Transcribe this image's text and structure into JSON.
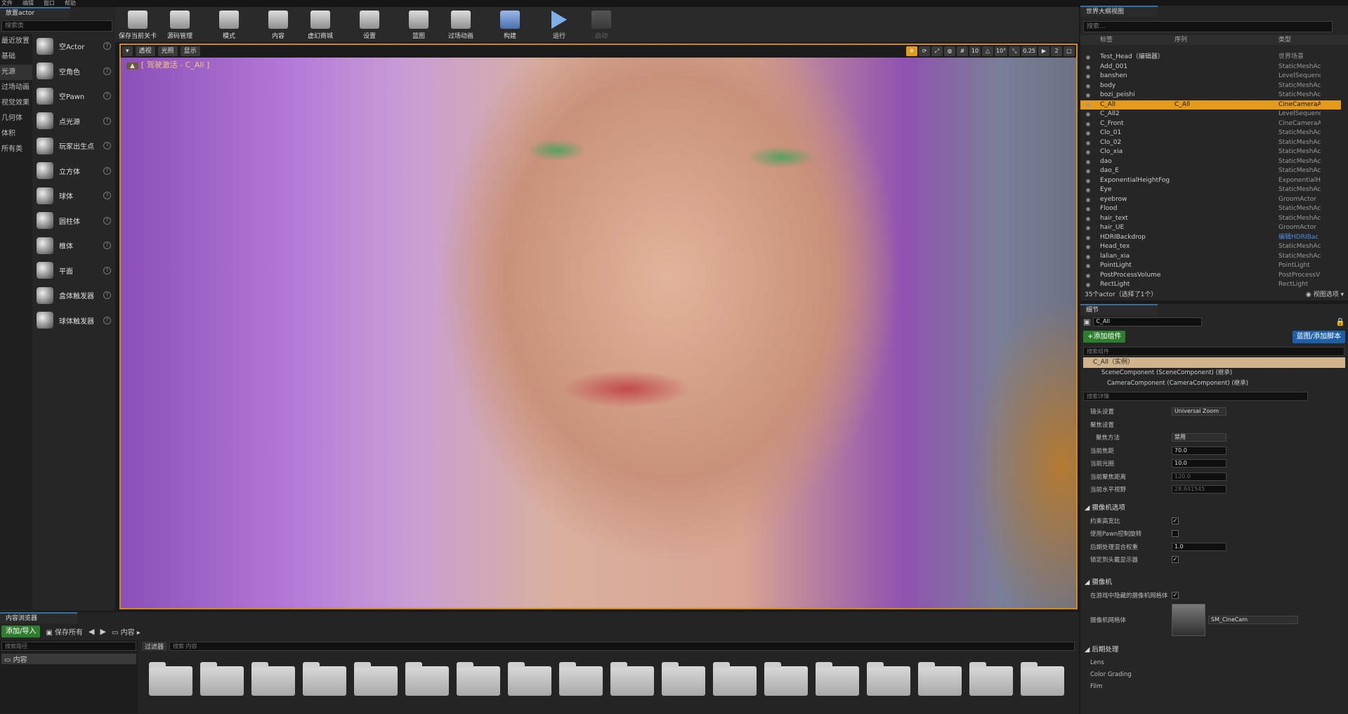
{
  "menu": [
    "文件",
    "编辑",
    "窗口",
    "帮助"
  ],
  "place_actor": {
    "tab": "放置actor",
    "search_placeholder": "搜索类",
    "categories": [
      "最近放置",
      "基础",
      "光源",
      "过场动画",
      "视觉效果",
      "几何体",
      "体积",
      "所有类"
    ],
    "items": [
      "空Actor",
      "空角色",
      "空Pawn",
      "点光源",
      "玩家出生点",
      "立方体",
      "球体",
      "圆柱体",
      "椎体",
      "平面",
      "盒体触发器",
      "球体触发器"
    ]
  },
  "toolbar": {
    "buttons": [
      "保存当前关卡",
      "源码管理",
      "模式",
      "内容",
      "虚幻商城",
      "设置",
      "蓝图",
      "过场动画",
      "构建",
      "运行",
      "启动"
    ]
  },
  "viewport": {
    "perspective": "透视",
    "lit": "光照",
    "show": "显示",
    "pilot_label": "[ 驾驶激活 - C_All ]",
    "controls": [
      "10",
      "10°",
      "0.25",
      "2"
    ]
  },
  "outliner": {
    "tab": "世界大纲视图",
    "search_placeholder": "搜索...",
    "col_label": "标签",
    "col_seq": "序列",
    "col_type": "类型",
    "rows": [
      {
        "name": "Test_Head（编辑器）",
        "seq": "",
        "type": "世界场景"
      },
      {
        "name": "Add_001",
        "seq": "",
        "type": "StaticMeshAct"
      },
      {
        "name": "banshen",
        "seq": "",
        "type": "LevelSequence"
      },
      {
        "name": "body",
        "seq": "",
        "type": "StaticMeshAct"
      },
      {
        "name": "bozi_peishi",
        "seq": "",
        "type": "StaticMeshAct"
      },
      {
        "name": "C_All",
        "seq": "C_All",
        "type": "CineCameraA"
      },
      {
        "name": "C_All2",
        "seq": "",
        "type": "LevelSequence"
      },
      {
        "name": "C_Front",
        "seq": "",
        "type": "CineCameraA"
      },
      {
        "name": "Clo_01",
        "seq": "",
        "type": "StaticMeshAct"
      },
      {
        "name": "Clo_02",
        "seq": "",
        "type": "StaticMeshAct"
      },
      {
        "name": "Clo_xia",
        "seq": "",
        "type": "StaticMeshAct"
      },
      {
        "name": "dao",
        "seq": "",
        "type": "StaticMeshAct"
      },
      {
        "name": "dao_E",
        "seq": "",
        "type": "StaticMeshAct"
      },
      {
        "name": "ExponentialHeightFog",
        "seq": "",
        "type": "ExponentialHe"
      },
      {
        "name": "Eye",
        "seq": "",
        "type": "StaticMeshAct"
      },
      {
        "name": "eyebrow",
        "seq": "",
        "type": "GroomActor"
      },
      {
        "name": "Flood",
        "seq": "",
        "type": "StaticMeshAct"
      },
      {
        "name": "hair_text",
        "seq": "",
        "type": "StaticMeshAct"
      },
      {
        "name": "hair_UE",
        "seq": "",
        "type": "GroomActor"
      },
      {
        "name": "HDRIBackdrop",
        "seq": "",
        "type": "编辑HDRIBac"
      },
      {
        "name": "Head_tex",
        "seq": "",
        "type": "StaticMeshAct"
      },
      {
        "name": "lalian_xia",
        "seq": "",
        "type": "StaticMeshAct"
      },
      {
        "name": "PointLight",
        "seq": "",
        "type": "PointLight"
      },
      {
        "name": "PostProcessVolume",
        "seq": "",
        "type": "PostProcessV"
      },
      {
        "name": "RectLight",
        "seq": "",
        "type": "RectLight"
      }
    ],
    "status": "35个actor（选择了1个）",
    "view_options": "视图选项"
  },
  "details": {
    "tab": "细节",
    "name_value": "C_All",
    "add_component": "+添加组件",
    "blueprint_btn": "蓝图/添加脚本",
    "search_components": "搜索组件",
    "instance": "C_All（实例）",
    "comp1": "SceneComponent (SceneComponent) (继承)",
    "comp2": "CameraComponent (CameraComponent) (继承)",
    "search_details": "搜索详情",
    "props": [
      {
        "label": "镜头设置",
        "value": "Universal Zoom"
      },
      {
        "label": "聚焦设置",
        "value": ""
      },
      {
        "label": "聚焦方法",
        "value": "禁用"
      },
      {
        "label": "当前焦距",
        "value": "70.0"
      },
      {
        "label": "当前光圈",
        "value": "10.0"
      },
      {
        "label": "当前聚焦距离",
        "value": "120.0"
      },
      {
        "label": "当前水平视野",
        "value": "28.841545"
      }
    ],
    "cat_camera_options": "摄像机选项",
    "camopts": [
      {
        "label": "约束高宽比",
        "value": "✓"
      },
      {
        "label": "使用Pawn控制旋转",
        "value": ""
      },
      {
        "label": "后期处理混合权重",
        "value": "1.0"
      },
      {
        "label": "锁定到头戴显示器",
        "value": "✓"
      }
    ],
    "cat_camera": "摄像机",
    "hide_mesh": "在游戏中隐藏的摄像机网格体",
    "mesh_label": "摄像机网格体",
    "mesh_value": "SM_CineCam",
    "cat_post": "后期处理",
    "sub": [
      "Lens",
      "Color Grading",
      "Film"
    ]
  },
  "content_browser": {
    "tab": "内容浏览器",
    "add_import": "添加/导入",
    "save_all": "保存所有",
    "path": "内容",
    "search_path": "搜索路径",
    "filters": "过滤器",
    "search_content": "搜索 内容",
    "tree_root": "内容"
  }
}
